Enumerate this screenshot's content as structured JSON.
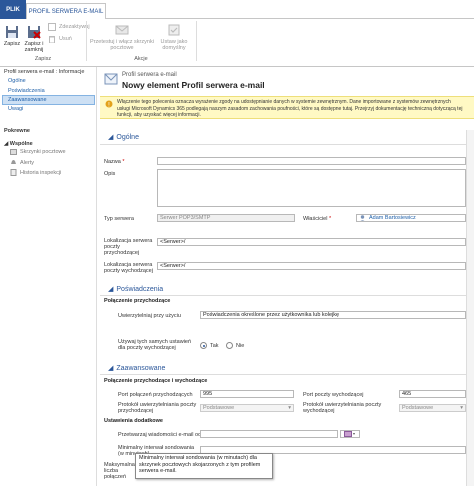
{
  "tabs": {
    "file": "PLIK",
    "profile": "PROFIL SERWERA E-MAIL"
  },
  "ribbon": {
    "save": "Zapisz",
    "save_close": "Zapisz i zamknij",
    "deactivate": "Zdezaktywuj",
    "delete": "Usuń",
    "group_save": "Zapisz",
    "test": "Przetestuj i włącz skrzynki pocztowe",
    "set_default": "Ustaw jako domyślny",
    "group_actions": "Akcje"
  },
  "nav": {
    "record_title": "Profil serwera e-mail : Informacje",
    "links": [
      "Ogólne",
      "Poświadczenia",
      "Zaawansowane",
      "Uwagi"
    ],
    "related_hdr": "Pokrewne",
    "common_hdr": "Wspólne",
    "related_items": [
      "Skrzynki pocztowe",
      "Alerty",
      "Historia inspekcji"
    ]
  },
  "header": {
    "entity": "Profil serwera e-mail",
    "title": "Nowy element Profil serwera e-mail"
  },
  "notice": {
    "line1": "Włączenie tego polecenia oznacza wyrażenie zgody na udostępnianie danych w systemie zewnętrznym. Dane importowane z systemów zewnętrznych",
    "line2": "usługi Microsoft Dynamics 365 podlegają naszym zasadom zachowania poufności, które są dostępne tutaj. Przejrzyj dokumentację techniczną dotyczącą tej",
    "line3": "funkcji, aby uzyskać więcej informacji."
  },
  "general": {
    "section": "Ogólne",
    "name_label": "Nazwa",
    "desc_label": "Opis",
    "server_type_label": "Typ serwera",
    "server_type_value": "Serwer POP3/SMTP",
    "owner_label": "Właściciel",
    "owner_value": "Adam Bartosiewicz",
    "incoming_label": "Lokalizacja serwera poczty przychodzącej",
    "incoming_value": "<Serwer>/",
    "outgoing_label": "Lokalizacja serwera poczty wychodzącej",
    "outgoing_value": "<Serwer>/"
  },
  "credentials": {
    "section": "Poświadczenia",
    "incoming_conn": "Połączenie przychodzące",
    "auth_label": "Uwierzytelniaj przy użyciu",
    "auth_value": "Poświadczenia określone przez użytkownika lub kolejkę",
    "same_label": "Używaj tych samych ustawień dla poczty wychodzącej",
    "yes": "Tak",
    "no": "Nie"
  },
  "advanced": {
    "section": "Zaawansowane",
    "conn_hdr": "Połączenie przychodzące i wychodzące",
    "in_port_label": "Port połączeń przychodzących",
    "in_port_value": "995",
    "out_port_label": "Port poczty wychodzącej",
    "out_port_value": "465",
    "in_proto_label": "Protokół uwierzytelniania poczty przychodzącej",
    "in_proto_value": "Podstawowe",
    "out_proto_label": "Protokół uwierzytelniania poczty wychodzącej",
    "out_proto_value": "Podstawowe",
    "extra_hdr": "Ustawienia dodatkowe",
    "process_label": "Przetwarzaj wiadomości e-mail od",
    "min_interval_label": "Minimalny interwał sondowania (w minutach)",
    "max_conn_label": "Maksymalna liczba połączeń"
  },
  "tooltip": "Minimalny interwał sondowania (w minutach) dla skrzynek pocztowych skojarzonych z tym profilem serwera e-mail.",
  "colors": {
    "accent": "#2b579a",
    "notice_bg": "#fff9c4",
    "selected_nav": "#cde0f4"
  }
}
